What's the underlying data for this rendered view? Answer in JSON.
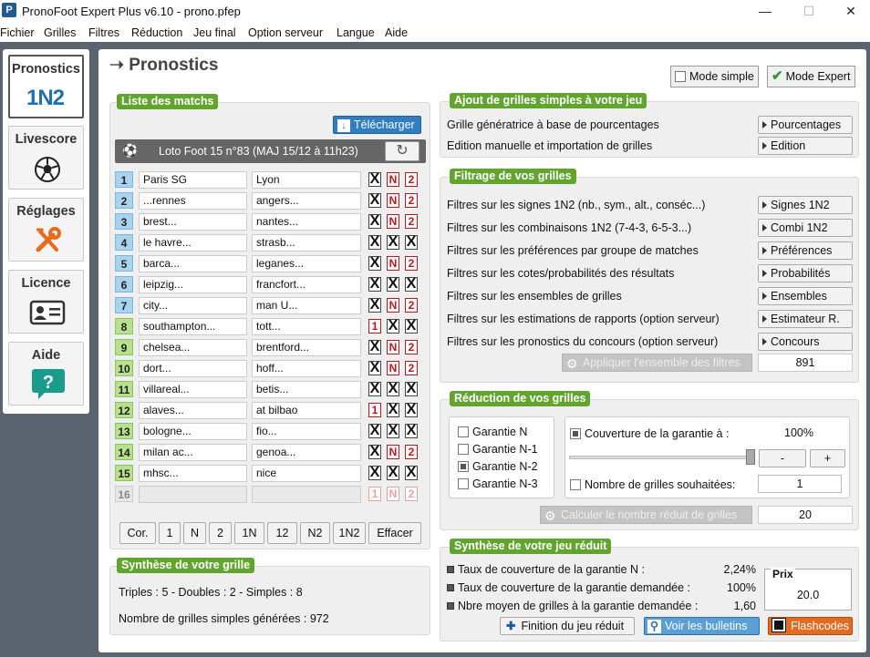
{
  "window": {
    "title": "PronoFoot Expert Plus v6.10 - prono.pfep",
    "app_icon": "P",
    "minimize": "—",
    "maximize": "☐",
    "close": "✕"
  },
  "menu": [
    "Fichier",
    "Grilles",
    "Filtres",
    "Réduction",
    "Jeu final",
    "Option serveur",
    "Langue",
    "Aide"
  ],
  "sidebar": {
    "pronostics": {
      "label": "Pronostics",
      "badge": "1N2"
    },
    "livescore": {
      "label": "Livescore"
    },
    "reglages": {
      "label": "Réglages"
    },
    "licence": {
      "label": "Licence"
    },
    "aide": {
      "label": "Aide",
      "badge": "?"
    }
  },
  "header": {
    "arrow": "➝",
    "title": "Pronostics",
    "mode_simple": "Mode simple",
    "mode_expert": "Mode Expert"
  },
  "matches": {
    "title": "Liste des matchs",
    "download": "Télécharger",
    "contest": "Loto Foot 15 n°83 (MAJ 15/12 à 11h23)",
    "rows": [
      {
        "n": "1",
        "home": "Paris SG",
        "away": "Lyon",
        "s": [
          "X",
          "N",
          "2"
        ],
        "c": "blue"
      },
      {
        "n": "2",
        "home": "...rennes",
        "away": "angers...",
        "s": [
          "X",
          "N",
          "2"
        ],
        "c": "blue"
      },
      {
        "n": "3",
        "home": "brest...",
        "away": "nantes...",
        "s": [
          "X",
          "N",
          "2"
        ],
        "c": "blue"
      },
      {
        "n": "4",
        "home": "le havre...",
        "away": "strasb...",
        "s": [
          "X",
          "X",
          "X"
        ],
        "c": "blue"
      },
      {
        "n": "5",
        "home": "barca...",
        "away": "leganes...",
        "s": [
          "X",
          "N",
          "2"
        ],
        "c": "blue"
      },
      {
        "n": "6",
        "home": "leipzig...",
        "away": "francfort...",
        "s": [
          "X",
          "X",
          "X"
        ],
        "c": "blue"
      },
      {
        "n": "7",
        "home": "city...",
        "away": "man U...",
        "s": [
          "X",
          "N",
          "2"
        ],
        "c": "blue"
      },
      {
        "n": "8",
        "home": "southampton...",
        "away": "tott...",
        "s": [
          "1",
          "X",
          "X"
        ],
        "c": "green"
      },
      {
        "n": "9",
        "home": "chelsea...",
        "away": "brentford...",
        "s": [
          "X",
          "N",
          "2"
        ],
        "c": "green"
      },
      {
        "n": "10",
        "home": "dort...",
        "away": "hoff...",
        "s": [
          "X",
          "N",
          "2"
        ],
        "c": "green"
      },
      {
        "n": "11",
        "home": "villareal...",
        "away": "betis...",
        "s": [
          "X",
          "X",
          "X"
        ],
        "c": "green"
      },
      {
        "n": "12",
        "home": "alaves...",
        "away": "at bilbao",
        "s": [
          "1",
          "X",
          "X"
        ],
        "c": "green"
      },
      {
        "n": "13",
        "home": "bologne...",
        "away": "fio...",
        "s": [
          "X",
          "X",
          "X"
        ],
        "c": "green"
      },
      {
        "n": "14",
        "home": "milan ac...",
        "away": " genoa...",
        "s": [
          "X",
          "N",
          "2"
        ],
        "c": "green"
      },
      {
        "n": "15",
        "home": "mhsc...",
        "away": "nice",
        "s": [
          "X",
          "X",
          "X"
        ],
        "c": "green"
      },
      {
        "n": "16",
        "home": "",
        "away": "",
        "s": [
          "1",
          "N",
          "2"
        ],
        "c": "off"
      }
    ],
    "buttons": [
      "Cor.",
      "1",
      "N",
      "2",
      "1N",
      "12",
      "N2",
      "1N2",
      "Effacer"
    ]
  },
  "synthese": {
    "title": "Synthèse de votre grille",
    "line1": "Triples : 5 - Doubles : 2 - Simples : 8",
    "line2": "Nombre de grilles simples générées : 972"
  },
  "ajout": {
    "title": "Ajout de grilles simples à votre jeu",
    "rows": [
      {
        "label": "Grille génératrice à base de pourcentages",
        "btn": "Pourcentages"
      },
      {
        "label": "Edition manuelle et importation de grilles",
        "btn": "Edition"
      }
    ]
  },
  "filtrage": {
    "title": "Filtrage de vos grilles",
    "rows": [
      {
        "label": "Filtres sur les signes 1N2 (nb., sym., alt., conséc...)",
        "btn": "Signes 1N2"
      },
      {
        "label": "Filtres sur les combinaisons 1N2 (7-4-3, 6-5-3...)",
        "btn": "Combi 1N2"
      },
      {
        "label": "Filtres sur les préférences par groupe de matches",
        "btn": "Préférences"
      },
      {
        "label": "Filtres sur les cotes/probabilités des résultats",
        "btn": "Probabilités"
      },
      {
        "label": "Filtres sur les ensembles de grilles",
        "btn": "Ensembles"
      },
      {
        "label": "Filtres sur les estimations de rapports (option serveur)",
        "btn": "Estimateur R."
      },
      {
        "label": "Filtres sur les pronostics du concours (option serveur)",
        "btn": "Concours"
      }
    ],
    "apply": "Appliquer l'ensemble des filtres",
    "count": "891"
  },
  "reduction": {
    "title": "Réduction de vos grilles",
    "garanties": [
      "Garantie N",
      "Garantie N-1",
      "Garantie N-2",
      "Garantie N-3"
    ],
    "selected_index": 2,
    "couverture_label": "Couverture de la garantie à :",
    "couverture_value": "100%",
    "slider_level": 1.0,
    "minus": "-",
    "plus": "+",
    "nb_label": "Nombre de grilles souhaitées:",
    "nb_value": "1",
    "calc": "Calculer le nombre réduit de grilles",
    "calc_value": "20"
  },
  "synth_reduit": {
    "title": "Synthèse de votre jeu réduit",
    "rows": [
      {
        "label": "Taux de couverture de la garantie N :",
        "value": "2,24%"
      },
      {
        "label": "Taux de couverture de la garantie demandée :",
        "value": "100%"
      },
      {
        "label": "Nbre moyen de grilles à la garantie demandée :",
        "value": "1,60"
      }
    ],
    "prix_label": "Prix",
    "prix_value": "20.0",
    "finition": "Finition du jeu réduit",
    "bulletins": "Voir les bulletins",
    "flashcodes": "Flashcodes"
  }
}
